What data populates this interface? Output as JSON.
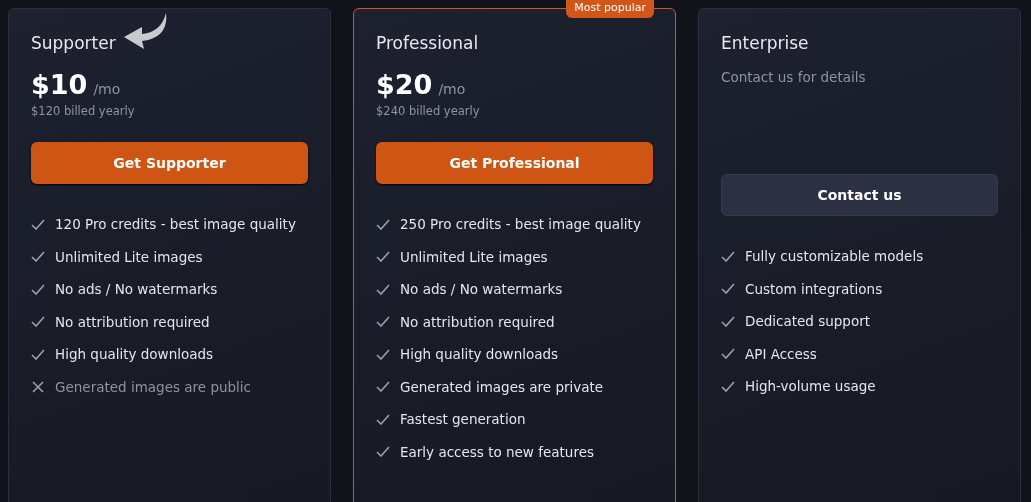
{
  "plans": [
    {
      "kind": "priced",
      "name": "Supporter",
      "pointer_arrow": true,
      "featured": false,
      "price_symbol": "$",
      "price": "10",
      "period": "/mo",
      "billing": "$120 billed yearly",
      "button": "Get Supporter",
      "features": [
        {
          "text": "120 Pro credits - best image quality",
          "included": true
        },
        {
          "text": "Unlimited Lite images",
          "included": true
        },
        {
          "text": "No ads / No watermarks",
          "included": true
        },
        {
          "text": "No attribution required",
          "included": true
        },
        {
          "text": "High quality downloads",
          "included": true
        },
        {
          "text": "Generated images are public",
          "included": false
        }
      ]
    },
    {
      "kind": "priced",
      "name": "Professional",
      "pointer_arrow": false,
      "featured": true,
      "badge": "Most popular",
      "price_symbol": "$",
      "price": "20",
      "period": "/mo",
      "billing": "$240 billed yearly",
      "button": "Get Professional",
      "features": [
        {
          "text": "250 Pro credits - best image quality",
          "included": true
        },
        {
          "text": "Unlimited Lite images",
          "included": true
        },
        {
          "text": "No ads / No watermarks",
          "included": true
        },
        {
          "text": "No attribution required",
          "included": true
        },
        {
          "text": "High quality downloads",
          "included": true
        },
        {
          "text": "Generated images are private",
          "included": true
        },
        {
          "text": "Fastest generation",
          "included": true
        },
        {
          "text": "Early access to new features",
          "included": true
        }
      ]
    },
    {
      "kind": "contact",
      "name": "Enterprise",
      "pointer_arrow": false,
      "featured": false,
      "subtitle": "Contact us for details",
      "button": "Contact us",
      "features": [
        {
          "text": "Fully customizable models",
          "included": true
        },
        {
          "text": "Custom integrations",
          "included": true
        },
        {
          "text": "Dedicated support",
          "included": true
        },
        {
          "text": "API Access",
          "included": true
        },
        {
          "text": "High-volume usage",
          "included": true
        }
      ]
    }
  ]
}
